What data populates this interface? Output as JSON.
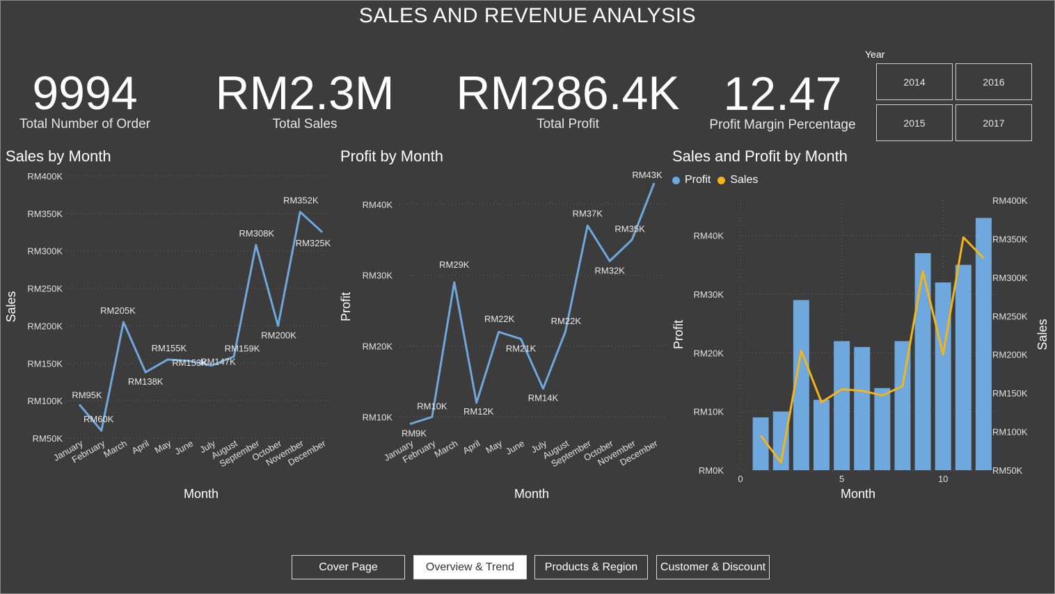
{
  "page_title": "SALES AND REVENUE ANALYSIS",
  "kpis": [
    {
      "value": "9994",
      "label": "Total Number of Order"
    },
    {
      "value": "RM2.3M",
      "label": "Total Sales"
    },
    {
      "value": "RM286.4K",
      "label": "Total Profit"
    },
    {
      "value": "12.47",
      "label": "Profit Margin Percentage"
    }
  ],
  "year_slicer": {
    "title": "Year",
    "options": [
      "2014",
      "2016",
      "2015",
      "2017"
    ]
  },
  "colors": {
    "background": "#3c3c3c",
    "profit_blue": "#6fa8dc",
    "sales_yellow": "#f4b41a",
    "grid": "#6a6a6a",
    "text": "#ffffff"
  },
  "nav": {
    "buttons": [
      "Cover Page",
      "Overview & Trend",
      "Products & Region",
      "Customer & Discount"
    ],
    "active": "Overview & Trend"
  },
  "chart_data": [
    {
      "type": "line",
      "title": "Sales by Month",
      "xlabel": "Month",
      "ylabel": "Sales",
      "categories": [
        "January",
        "February",
        "March",
        "April",
        "May",
        "June",
        "July",
        "August",
        "September",
        "October",
        "November",
        "December"
      ],
      "values": [
        95,
        60,
        205,
        138,
        155,
        153,
        147,
        159,
        308,
        200,
        352,
        325
      ],
      "data_labels": [
        "RM95K",
        "RM60K",
        "RM205K",
        "RM138K",
        "RM155K",
        "RM153K",
        "RM147K",
        "RM159K",
        "RM308K",
        "RM200K",
        "RM352K",
        "RM325K"
      ],
      "unit": "K",
      "ylim": [
        50,
        400
      ],
      "yticks": [
        50,
        100,
        150,
        200,
        250,
        300,
        350,
        400
      ],
      "ytick_labels": [
        "RM50K",
        "RM100K",
        "RM150K",
        "RM200K",
        "RM250K",
        "RM300K",
        "RM350K",
        "RM400K"
      ],
      "color": "#6fa8dc",
      "grid": true
    },
    {
      "type": "line",
      "title": "Profit by Month",
      "xlabel": "Month",
      "ylabel": "Profit",
      "categories": [
        "January",
        "February",
        "March",
        "April",
        "May",
        "June",
        "July",
        "August",
        "September",
        "October",
        "November",
        "December"
      ],
      "values": [
        9,
        10,
        29,
        12,
        22,
        21,
        14,
        22,
        37,
        32,
        35,
        43
      ],
      "data_labels": [
        "RM9K",
        "RM10K",
        "RM29K",
        "RM12K",
        "RM22K",
        "RM21K",
        "RM14K",
        "RM22K",
        "RM37K",
        "RM32K",
        "RM35K",
        "RM43K"
      ],
      "unit": "K",
      "ylim": [
        7,
        44
      ],
      "yticks": [
        10,
        20,
        30,
        40
      ],
      "ytick_labels": [
        "RM10K",
        "RM20K",
        "RM30K",
        "RM40K"
      ],
      "color": "#6fa8dc",
      "grid": true
    },
    {
      "type": "bar",
      "title": "Sales and Profit by Month",
      "xlabel": "Month",
      "ylabel": "Profit",
      "y2label": "Sales",
      "x": [
        1,
        2,
        3,
        4,
        5,
        6,
        7,
        8,
        9,
        10,
        11,
        12
      ],
      "xlim": [
        0,
        12.5
      ],
      "xticks": [
        0,
        5,
        10
      ],
      "xtick_labels": [
        "0",
        "5",
        "10"
      ],
      "series": [
        {
          "name": "Profit",
          "type": "bar",
          "axis": "left",
          "values": [
            9,
            10,
            29,
            12,
            22,
            21,
            14,
            22,
            37,
            32,
            35,
            43
          ],
          "color": "#6fa8dc"
        },
        {
          "name": "Sales",
          "type": "line",
          "axis": "right",
          "values": [
            95,
            60,
            205,
            138,
            155,
            153,
            147,
            159,
            308,
            200,
            352,
            325
          ],
          "color": "#f4b41a"
        }
      ],
      "ylim": [
        0,
        46
      ],
      "yticks": [
        0,
        10,
        20,
        30,
        40
      ],
      "ytick_labels": [
        "RM0K",
        "RM10K",
        "RM20K",
        "RM30K",
        "RM40K"
      ],
      "y2lim": [
        50,
        400
      ],
      "y2ticks": [
        50,
        100,
        150,
        200,
        250,
        300,
        350,
        400
      ],
      "y2tick_labels": [
        "RM50K",
        "RM100K",
        "RM150K",
        "RM200K",
        "RM250K",
        "RM300K",
        "RM350K",
        "RM400K"
      ],
      "legend_position": "top-left",
      "grid": true
    }
  ]
}
